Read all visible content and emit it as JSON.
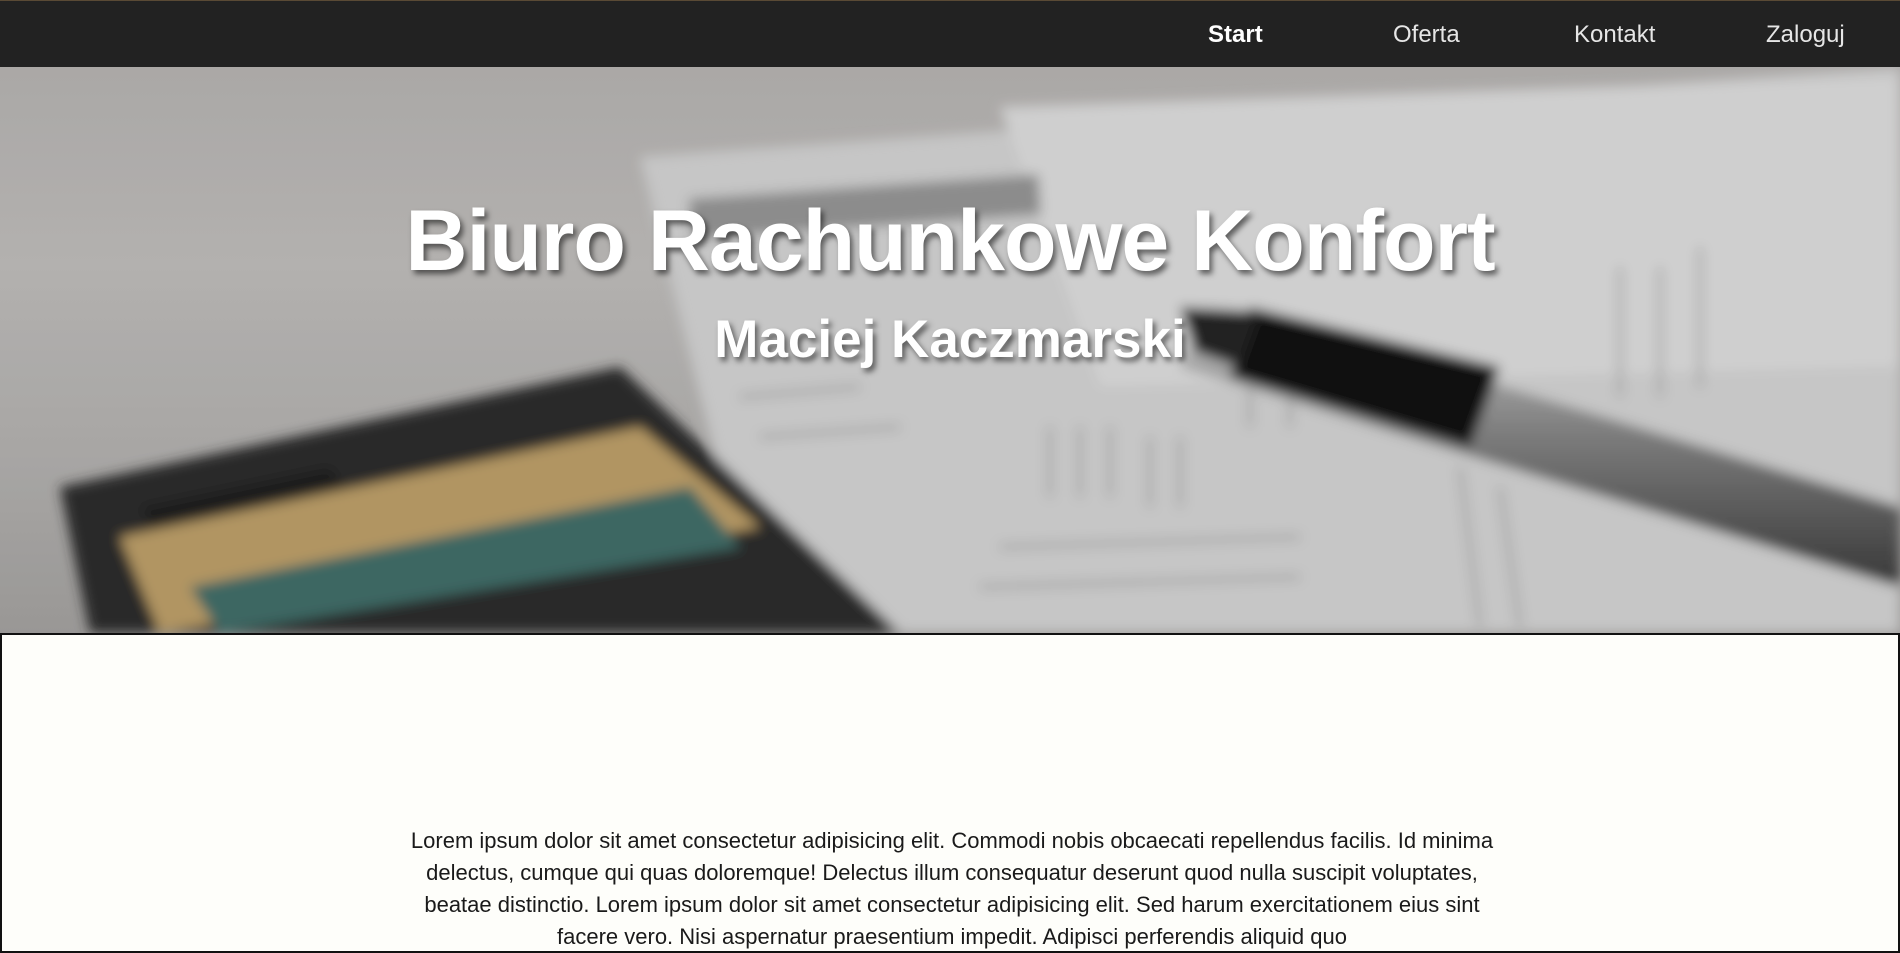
{
  "nav": {
    "items": [
      {
        "label": "Start",
        "active": true
      },
      {
        "label": "Oferta",
        "active": false
      },
      {
        "label": "Kontakt",
        "active": false
      },
      {
        "label": "Zaloguj",
        "active": false
      }
    ]
  },
  "hero": {
    "title": "Biuro Rachunkowe Konfort",
    "subtitle": "Maciej Kaczmarski",
    "image": "blurred photo of calculator, pen and documents"
  },
  "content": {
    "text": "Lorem ipsum dolor sit amet consectetur adipisicing elit. Commodi nobis obcaecati repellendus facilis. Id minima delectus, cumque qui quas doloremque! Delectus illum consequatur deserunt quod nulla suscipit voluptates, beatae distinctio. Lorem ipsum dolor sit amet consectetur adipisicing elit. Sed harum exercitationem eius sint facere vero. Nisi aspernatur praesentium impedit. Adipisci perferendis aliquid quo"
  },
  "colors": {
    "navbar_bg": "#222222",
    "nav_text": "#e6e6e6",
    "content_bg": "#fefefa"
  }
}
